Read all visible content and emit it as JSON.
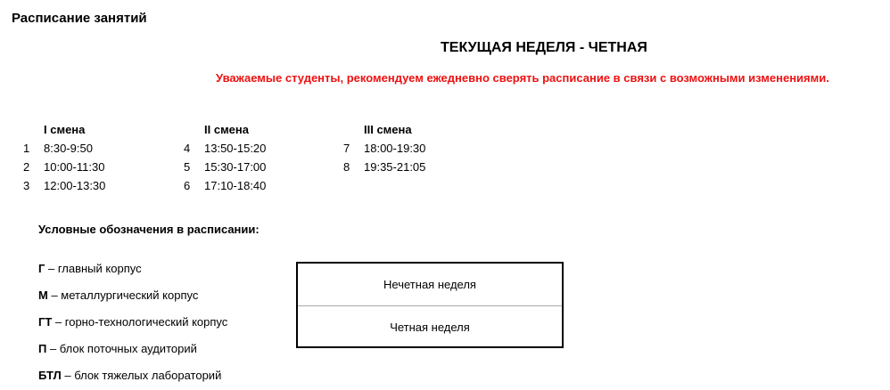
{
  "header": {
    "title": "Расписание занятий",
    "current_week": "ТЕКУЩАЯ НЕДЕЛЯ - ЧЕТНАЯ",
    "notice": "Уважаемые студенты, рекомендуем ежедневно сверять расписание в связи с возможными изменениями."
  },
  "shifts": [
    {
      "title": "I смена",
      "slots": [
        {
          "num": "1",
          "time": "8:30-9:50"
        },
        {
          "num": "2",
          "time": "10:00-11:30"
        },
        {
          "num": "3",
          "time": "12:00-13:30"
        }
      ]
    },
    {
      "title": "II смена",
      "slots": [
        {
          "num": "4",
          "time": "13:50-15:20"
        },
        {
          "num": "5",
          "time": "15:30-17:00"
        },
        {
          "num": "6",
          "time": "17:10-18:40"
        }
      ]
    },
    {
      "title": "III смена",
      "slots": [
        {
          "num": "7",
          "time": "18:00-19:30"
        },
        {
          "num": "8",
          "time": "19:35-21:05"
        }
      ]
    }
  ],
  "legend": {
    "title": "Условные обозначения в расписании:",
    "items": [
      {
        "code": "Г",
        "desc": " – главный корпус"
      },
      {
        "code": "М",
        "desc": " – металлургический корпус"
      },
      {
        "code": "ГТ",
        "desc": " – горно-технологический корпус"
      },
      {
        "code": "П",
        "desc": " – блок поточных аудиторий"
      },
      {
        "code": "БТЛ",
        "desc": " – блок тяжелых лабораторий"
      }
    ]
  },
  "week_types": {
    "odd": "Нечетная неделя",
    "even": "Четная неделя"
  },
  "colors": {
    "notice": "#ee1111",
    "text": "#000000",
    "box_border": "#000000",
    "box_divider": "#a9a9a9"
  }
}
